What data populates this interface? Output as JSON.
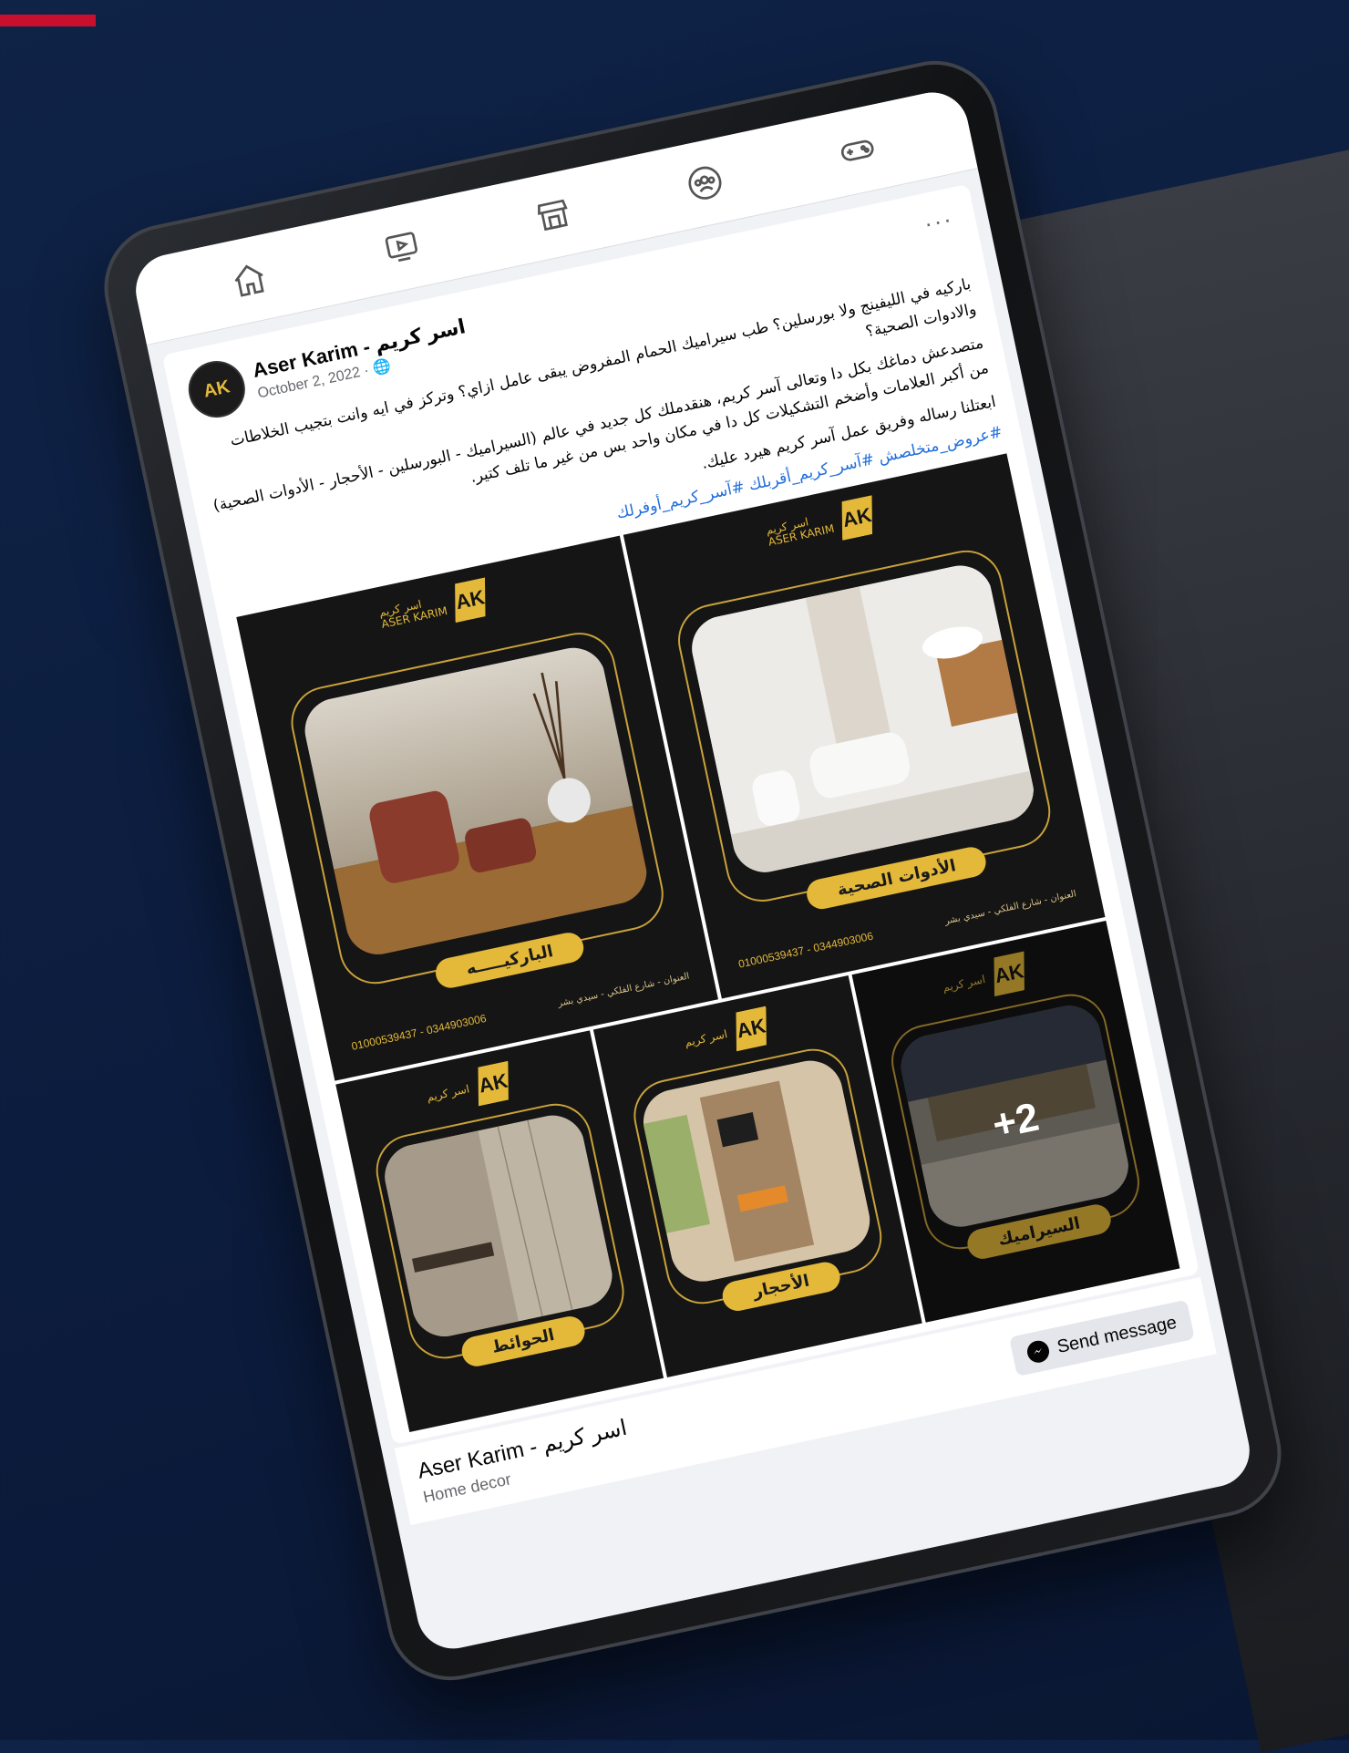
{
  "nav": {
    "items": [
      "home",
      "watch",
      "marketplace",
      "groups",
      "gaming"
    ]
  },
  "post": {
    "author": "Aser Karim - اسر كريم",
    "date": "October 2, 2022 · ",
    "more": "···",
    "avatar_text": "AK",
    "paragraphs": [
      "باركيه في الليفينج ولا بورسلين؟ طب سيراميك الحمام المفروض يبقى عامل ازاي؟ وتركز في ايه وانت بتجيب الخلاطات والادوات الصحية؟",
      "متصدعش دماغك بكل دا وتعالى آسر كريم، هنقدملك كل جديد في عالم (السيراميك - البورسلين - الأحجار - الأدوات الصحية) من أكبر العلامات وأضخم التشكيلات كل دا في مكان واحد بس من غير ما تلف كتير.",
      "ابعتلنا رساله وفريق عمل آسر كريم هيرد عليك."
    ],
    "hashtags": "#عروض_متخلصش #آسر_كريم_أقربلك #آسر_كريم_أوفرلك"
  },
  "gallery": {
    "logo_text_ar": "اسر كريم",
    "logo_text_en": "ASER KARIM",
    "phones": "01000539437 - 0344903006",
    "address": "العنوان - شارع الفلكي - سيدي بشر",
    "tiles": [
      {
        "label": "الباركيـــــه"
      },
      {
        "label": "الأدوات الصحية"
      },
      {
        "label": "الحوائط"
      },
      {
        "label": "الأحجار"
      },
      {
        "label": "السيراميك"
      }
    ],
    "more_count": "+2"
  },
  "footer": {
    "page_name": "Aser Karim - اسر كريم",
    "category": "Home decor",
    "send_message": "Send message"
  },
  "colors": {
    "gold": "#e4b93a",
    "tile_bg": "#151515",
    "link": "#216fdb",
    "accent_red": "#c8102e",
    "background": "#0c1c3d"
  }
}
